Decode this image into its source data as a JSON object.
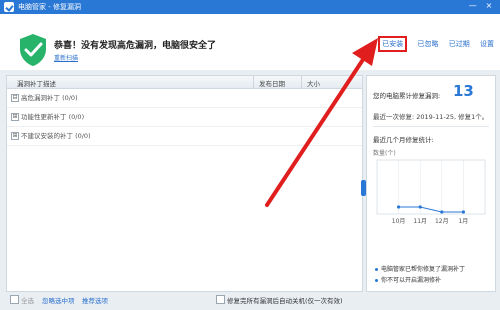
{
  "window": {
    "title": "电脑管家 - 修复漏洞",
    "controls": [
      "—",
      "×"
    ]
  },
  "header": {
    "headline": "恭喜！没有发现高危漏洞，电脑很安全了",
    "rescan": "重新扫描",
    "tabs": [
      "已安装",
      "已忽略",
      "已过期",
      "设置"
    ]
  },
  "table": {
    "columns": [
      "漏洞补丁描述",
      "发布日期",
      "大小"
    ],
    "groups": [
      {
        "toggle": "⊟",
        "label": "高危漏洞补丁 (0/0)"
      },
      {
        "toggle": "⊞",
        "label": "功能性更新补丁 (0/0)"
      },
      {
        "toggle": "⊞",
        "label": "不建议安装的补丁 (0/0)"
      }
    ]
  },
  "stats": {
    "total_label": "您的电脑累计修复漏洞:",
    "total_count": "13",
    "last_fix": "最近一次修复: 2019-11-25, 修复1个。",
    "recent_label": "最近几个月修复统计:",
    "unit_label": "数量(个)"
  },
  "chart_data": {
    "type": "line",
    "categories": [
      "10月",
      "11月",
      "12月",
      "1月"
    ],
    "values": [
      1,
      1,
      0,
      0
    ],
    "ylim": [
      0,
      10
    ],
    "grid": true,
    "color": "#2a78d6"
  },
  "legend": [
    "电脑管家已帮你修复了漏洞补丁",
    "你不可以开启漏洞修补"
  ],
  "footer": {
    "select_all": "全选",
    "ignore_selected": "忽略选中项",
    "recommended": "推荐选项",
    "auto_shutdown": "修复完所有漏洞后自动关机(仅一次有效)"
  },
  "colors": {
    "accent": "#2a78d6",
    "highlight": "#e01e1e",
    "shield": "#27b36a"
  }
}
